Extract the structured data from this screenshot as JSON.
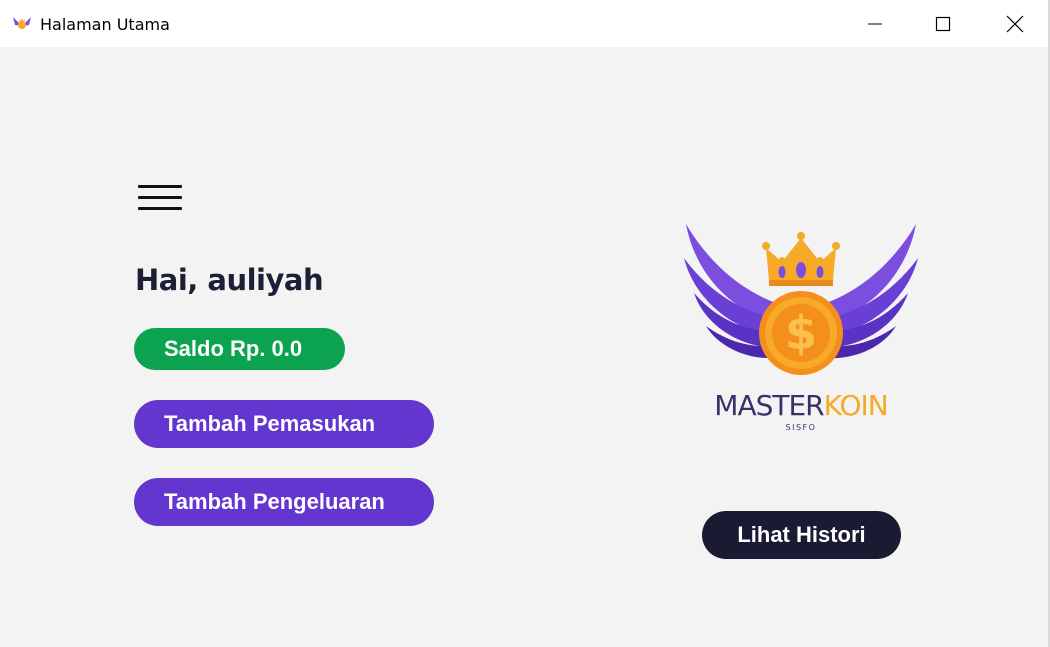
{
  "window": {
    "title": "Halaman Utama",
    "icon": "masterkoin-app-icon",
    "controls": [
      "minimize-icon",
      "maximize-icon",
      "close-icon"
    ]
  },
  "main": {
    "greeting": "Hai, auliyah",
    "balance_label": "Saldo Rp. 0.0",
    "add_income_label": "Tambah Pemasukan",
    "add_expense_label": "Tambah Pengeluaran",
    "history_label": "Lihat Histori"
  },
  "logo": {
    "brand_part1": "MASTER",
    "brand_part2": "KOIN",
    "tagline": "SISFO"
  },
  "colors": {
    "balance_pill": "#0ba34f",
    "action_buttons": "#6436d0",
    "history_button": "#1a1b33",
    "greeting_text": "#1c1f36",
    "logo_wings": "#7b4ee0",
    "logo_coin": "#f7a928"
  }
}
